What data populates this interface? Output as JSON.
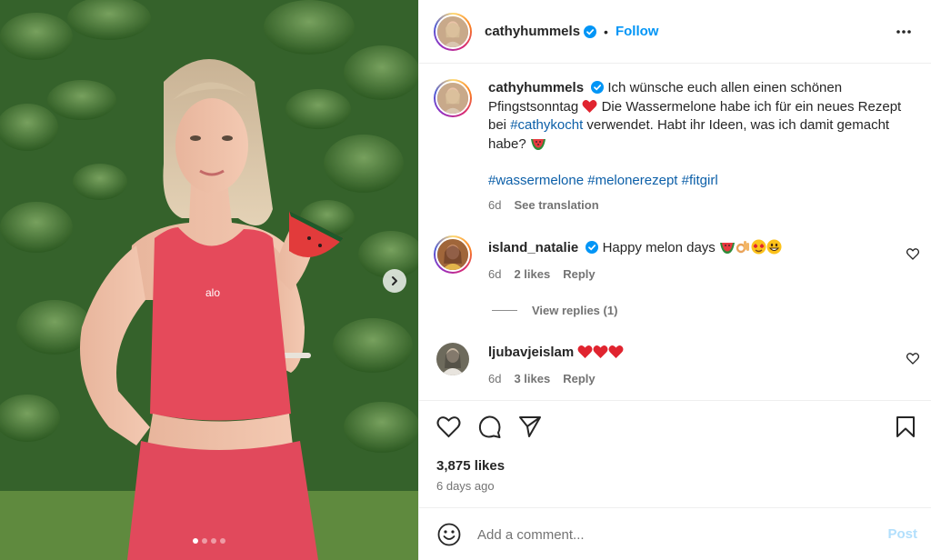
{
  "post": {
    "author": "cathyhummels",
    "follow_label": "Follow",
    "separator": "•",
    "caption": {
      "text_1": "Ich wünsche euch allen einen schönen Pfingstsonntag",
      "text_2": "Die Wassermelone habe ich für ein neues Rezept bei",
      "tag_1": "#cathykocht",
      "text_3": "verwendet. Habt ihr Ideen, was ich damit gemacht habe?",
      "hashtags": [
        "#wassermelone",
        "#melonerezept",
        "#fitgirl"
      ],
      "age": "6d",
      "translate_label": "See translation"
    },
    "likes": "3,875 likes",
    "posted": "6 days ago"
  },
  "comments": [
    {
      "user": "island_natalie",
      "verified": true,
      "text": "Happy melon days",
      "emojis": [
        "watermelon",
        "ok-hand",
        "heart-eyes",
        "grin"
      ],
      "age": "6d",
      "likes": "2 likes",
      "reply_label": "Reply"
    },
    {
      "user": "ljubavjeislam",
      "verified": false,
      "text": "",
      "emojis": [
        "red-heart",
        "red-heart",
        "red-heart"
      ],
      "age": "6d",
      "likes": "3 likes",
      "reply_label": "Reply"
    }
  ],
  "view_replies": "View replies (1)",
  "compose": {
    "placeholder": "Add a comment...",
    "post_label": "Post"
  },
  "carousel": {
    "slides": 4,
    "active": 0
  },
  "colors": {
    "verified": "#0095f6",
    "follow": "#0095f6",
    "post_disabled": "#b2dffc",
    "hashtag": "#0c5fa8"
  }
}
